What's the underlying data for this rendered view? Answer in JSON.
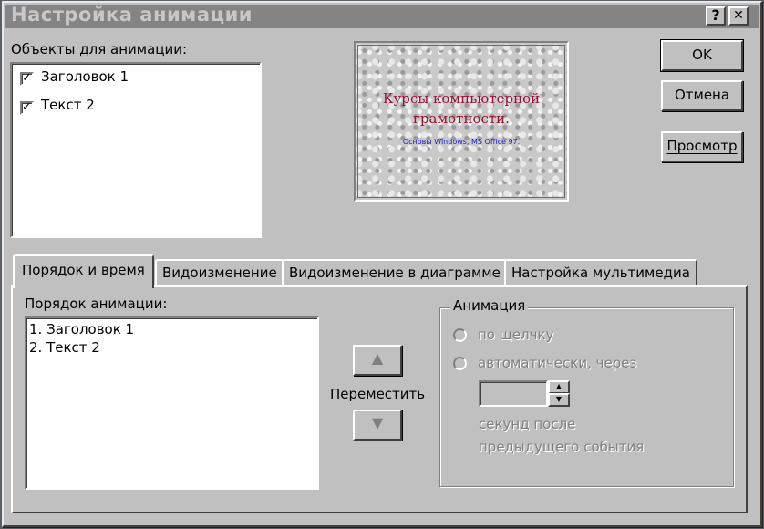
{
  "window": {
    "title": "Настройка анимации",
    "help_label": "?",
    "close_label": "✕"
  },
  "objects": {
    "label": "Объекты для анимации:",
    "items": [
      {
        "label": "Заголовок 1",
        "checked": true,
        "mark": "✓"
      },
      {
        "label": "Текст 2",
        "checked": true,
        "mark": "✓"
      }
    ]
  },
  "preview": {
    "title_line1": "Курсы компьютерной",
    "title_line2": "грамотности.",
    "subtitle": "Основы Windows, MS Office 97.",
    "title_color": "#9a1030",
    "subtitle_color": "#1a20d0"
  },
  "buttons": {
    "ok": "OK",
    "cancel": "Отмена",
    "preview": "Просмотр"
  },
  "tabs": [
    {
      "label": "Порядок и время",
      "active": true
    },
    {
      "label": "Видоизменение",
      "active": false
    },
    {
      "label": "Видоизменение в диаграмме",
      "active": false
    },
    {
      "label": "Настройка мультимедиа",
      "active": false
    }
  ],
  "order": {
    "label": "Порядок анимации:",
    "items": [
      "1. Заголовок 1",
      "2. Текст 2"
    ],
    "move_label": "Переместить",
    "up_icon": "▲",
    "down_icon": "▼"
  },
  "animation_group": {
    "legend": "Анимация",
    "on_click": "по щелчку",
    "auto": "автоматически, через",
    "seconds_line1": "секунд после",
    "seconds_line2": "предыдущего события",
    "spin_up": "▲",
    "spin_down": "▼"
  }
}
